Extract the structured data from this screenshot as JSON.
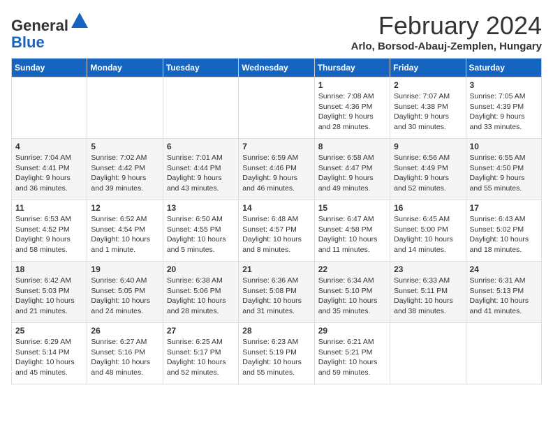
{
  "logo": {
    "general": "General",
    "blue": "Blue"
  },
  "header": {
    "month": "February 2024",
    "location": "Arlo, Borsod-Abauj-Zemplen, Hungary"
  },
  "days_of_week": [
    "Sunday",
    "Monday",
    "Tuesday",
    "Wednesday",
    "Thursday",
    "Friday",
    "Saturday"
  ],
  "weeks": [
    [
      {
        "day": "",
        "info": ""
      },
      {
        "day": "",
        "info": ""
      },
      {
        "day": "",
        "info": ""
      },
      {
        "day": "",
        "info": ""
      },
      {
        "day": "1",
        "info": "Sunrise: 7:08 AM\nSunset: 4:36 PM\nDaylight: 9 hours and 28 minutes."
      },
      {
        "day": "2",
        "info": "Sunrise: 7:07 AM\nSunset: 4:38 PM\nDaylight: 9 hours and 30 minutes."
      },
      {
        "day": "3",
        "info": "Sunrise: 7:05 AM\nSunset: 4:39 PM\nDaylight: 9 hours and 33 minutes."
      }
    ],
    [
      {
        "day": "4",
        "info": "Sunrise: 7:04 AM\nSunset: 4:41 PM\nDaylight: 9 hours and 36 minutes."
      },
      {
        "day": "5",
        "info": "Sunrise: 7:02 AM\nSunset: 4:42 PM\nDaylight: 9 hours and 39 minutes."
      },
      {
        "day": "6",
        "info": "Sunrise: 7:01 AM\nSunset: 4:44 PM\nDaylight: 9 hours and 43 minutes."
      },
      {
        "day": "7",
        "info": "Sunrise: 6:59 AM\nSunset: 4:46 PM\nDaylight: 9 hours and 46 minutes."
      },
      {
        "day": "8",
        "info": "Sunrise: 6:58 AM\nSunset: 4:47 PM\nDaylight: 9 hours and 49 minutes."
      },
      {
        "day": "9",
        "info": "Sunrise: 6:56 AM\nSunset: 4:49 PM\nDaylight: 9 hours and 52 minutes."
      },
      {
        "day": "10",
        "info": "Sunrise: 6:55 AM\nSunset: 4:50 PM\nDaylight: 9 hours and 55 minutes."
      }
    ],
    [
      {
        "day": "11",
        "info": "Sunrise: 6:53 AM\nSunset: 4:52 PM\nDaylight: 9 hours and 58 minutes."
      },
      {
        "day": "12",
        "info": "Sunrise: 6:52 AM\nSunset: 4:54 PM\nDaylight: 10 hours and 1 minute."
      },
      {
        "day": "13",
        "info": "Sunrise: 6:50 AM\nSunset: 4:55 PM\nDaylight: 10 hours and 5 minutes."
      },
      {
        "day": "14",
        "info": "Sunrise: 6:48 AM\nSunset: 4:57 PM\nDaylight: 10 hours and 8 minutes."
      },
      {
        "day": "15",
        "info": "Sunrise: 6:47 AM\nSunset: 4:58 PM\nDaylight: 10 hours and 11 minutes."
      },
      {
        "day": "16",
        "info": "Sunrise: 6:45 AM\nSunset: 5:00 PM\nDaylight: 10 hours and 14 minutes."
      },
      {
        "day": "17",
        "info": "Sunrise: 6:43 AM\nSunset: 5:02 PM\nDaylight: 10 hours and 18 minutes."
      }
    ],
    [
      {
        "day": "18",
        "info": "Sunrise: 6:42 AM\nSunset: 5:03 PM\nDaylight: 10 hours and 21 minutes."
      },
      {
        "day": "19",
        "info": "Sunrise: 6:40 AM\nSunset: 5:05 PM\nDaylight: 10 hours and 24 minutes."
      },
      {
        "day": "20",
        "info": "Sunrise: 6:38 AM\nSunset: 5:06 PM\nDaylight: 10 hours and 28 minutes."
      },
      {
        "day": "21",
        "info": "Sunrise: 6:36 AM\nSunset: 5:08 PM\nDaylight: 10 hours and 31 minutes."
      },
      {
        "day": "22",
        "info": "Sunrise: 6:34 AM\nSunset: 5:10 PM\nDaylight: 10 hours and 35 minutes."
      },
      {
        "day": "23",
        "info": "Sunrise: 6:33 AM\nSunset: 5:11 PM\nDaylight: 10 hours and 38 minutes."
      },
      {
        "day": "24",
        "info": "Sunrise: 6:31 AM\nSunset: 5:13 PM\nDaylight: 10 hours and 41 minutes."
      }
    ],
    [
      {
        "day": "25",
        "info": "Sunrise: 6:29 AM\nSunset: 5:14 PM\nDaylight: 10 hours and 45 minutes."
      },
      {
        "day": "26",
        "info": "Sunrise: 6:27 AM\nSunset: 5:16 PM\nDaylight: 10 hours and 48 minutes."
      },
      {
        "day": "27",
        "info": "Sunrise: 6:25 AM\nSunset: 5:17 PM\nDaylight: 10 hours and 52 minutes."
      },
      {
        "day": "28",
        "info": "Sunrise: 6:23 AM\nSunset: 5:19 PM\nDaylight: 10 hours and 55 minutes."
      },
      {
        "day": "29",
        "info": "Sunrise: 6:21 AM\nSunset: 5:21 PM\nDaylight: 10 hours and 59 minutes."
      },
      {
        "day": "",
        "info": ""
      },
      {
        "day": "",
        "info": ""
      }
    ]
  ]
}
